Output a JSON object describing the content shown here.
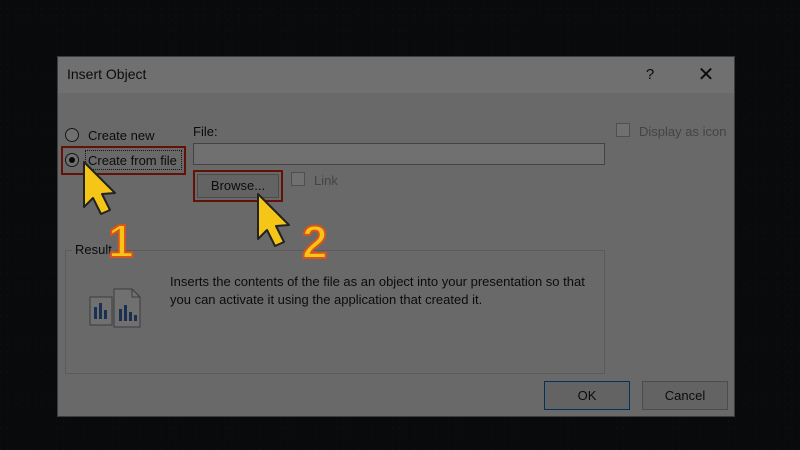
{
  "dialog": {
    "title": "Insert Object",
    "help_label": "?",
    "close_label": "✕"
  },
  "options": {
    "create_new": "Create new",
    "create_from_file": "Create from file",
    "selected": "create_from_file"
  },
  "file": {
    "label": "File:",
    "value": "",
    "browse_label": "Browse...",
    "link_label": "Link"
  },
  "display_as_icon_label": "Display as icon",
  "result": {
    "label": "Result",
    "text": "Inserts the contents of the file as an object into your presentation so that you can activate it using the application that created it."
  },
  "buttons": {
    "ok": "OK",
    "cancel": "Cancel"
  },
  "annotations": {
    "step1": "1",
    "step2": "2",
    "highlight_color": "#e02a10",
    "arrow_color": "#f5c518",
    "number_color": "#f5c518"
  }
}
